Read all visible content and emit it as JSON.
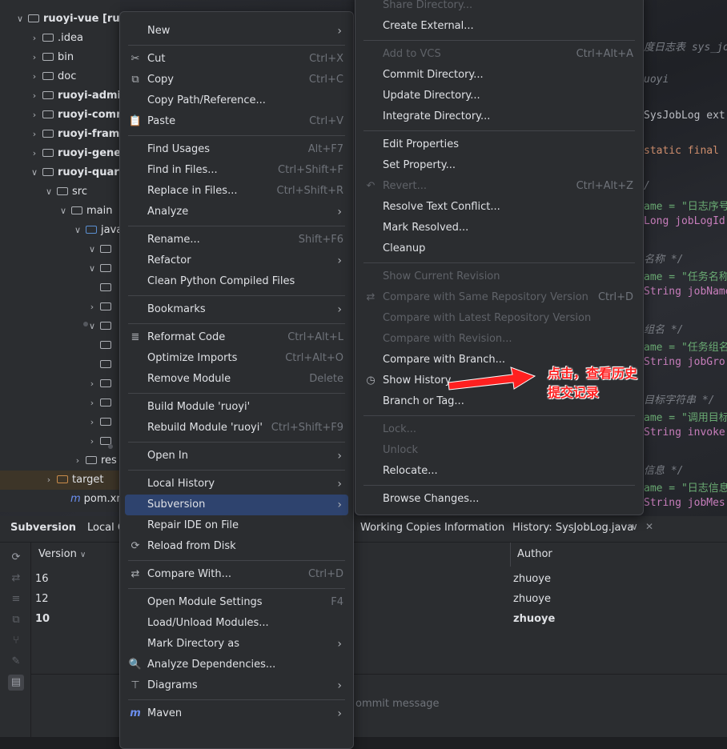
{
  "editor": {
    "lines": [
      {
        "text": "度日志表 sys_job",
        "cls": "c-cmt"
      },
      {
        "text": "uoyi",
        "cls": "c-cmt"
      },
      {
        "text": " SysJobLog ext",
        "cls": "c-plain"
      },
      {
        "text": "static final",
        "cls": "c-kw"
      },
      {
        "text": "/",
        "cls": "c-cmt"
      },
      {
        "text": "ame = \"日志序号",
        "cls": "c-str"
      },
      {
        "text": "Long jobLogId",
        "cls": "c-fld"
      },
      {
        "text": "名称 */",
        "cls": "c-cmt"
      },
      {
        "text": "ame = \"任务名称",
        "cls": "c-str"
      },
      {
        "text": "String jobName",
        "cls": "c-fld"
      },
      {
        "text": "组名 */",
        "cls": "c-cmt"
      },
      {
        "text": "ame = \"任务组名",
        "cls": "c-str"
      },
      {
        "text": "String jobGro",
        "cls": "c-fld"
      },
      {
        "text": "目标字符串 */",
        "cls": "c-cmt"
      },
      {
        "text": "ame = \"调用目标",
        "cls": "c-str"
      },
      {
        "text": "String invoke",
        "cls": "c-fld"
      },
      {
        "text": "信息 */",
        "cls": "c-cmt"
      },
      {
        "text": "ame = \"日志信息",
        "cls": "c-str"
      },
      {
        "text": "String jobMes",
        "cls": "c-fld"
      }
    ]
  },
  "tree": {
    "items": [
      {
        "label": "ruoyi-vue [ruoyi",
        "bold": true,
        "chev": "∨",
        "indent": 0
      },
      {
        "label": ".idea",
        "bold": false,
        "chev": "›",
        "indent": 1
      },
      {
        "label": "bin",
        "bold": false,
        "chev": "›",
        "indent": 1
      },
      {
        "label": "doc",
        "bold": false,
        "chev": "›",
        "indent": 1
      },
      {
        "label": "ruoyi-admin",
        "bold": true,
        "chev": "›",
        "indent": 1
      },
      {
        "label": "ruoyi-comm",
        "bold": true,
        "chev": "›",
        "indent": 1
      },
      {
        "label": "ruoyi-framew",
        "bold": true,
        "chev": "›",
        "indent": 1
      },
      {
        "label": "ruoyi-genera",
        "bold": true,
        "chev": "›",
        "indent": 1
      },
      {
        "label": "ruoyi-quartz",
        "bold": true,
        "chev": "∨",
        "indent": 1
      },
      {
        "label": "src",
        "bold": false,
        "chev": "∨",
        "indent": 2
      },
      {
        "label": "main",
        "bold": false,
        "chev": "∨",
        "indent": 3
      },
      {
        "label": "java",
        "bold": false,
        "chev": "∨",
        "indent": 4
      },
      {
        "label": "",
        "bold": false,
        "chev": "∨",
        "indent": 5
      },
      {
        "label": "",
        "bold": false,
        "chev": "∨",
        "indent": 5
      },
      {
        "label": "",
        "bold": false,
        "chev": "",
        "indent": 5
      },
      {
        "label": "",
        "bold": false,
        "chev": "›",
        "indent": 5
      },
      {
        "label": "",
        "bold": false,
        "chev": "∨",
        "indent": 5
      },
      {
        "label": "",
        "bold": false,
        "chev": "",
        "indent": 5
      },
      {
        "label": "",
        "bold": false,
        "chev": "",
        "indent": 5
      },
      {
        "label": "",
        "bold": false,
        "chev": "›",
        "indent": 5
      },
      {
        "label": "",
        "bold": false,
        "chev": "›",
        "indent": 5
      },
      {
        "label": "",
        "bold": false,
        "chev": "›",
        "indent": 5
      },
      {
        "label": "",
        "bold": false,
        "chev": "›",
        "indent": 5
      },
      {
        "label": "res",
        "bold": false,
        "chev": "›",
        "indent": 4
      },
      {
        "label": "target",
        "bold": false,
        "chev": "›",
        "indent": 2
      },
      {
        "label": "pom.xml",
        "bold": false,
        "chev": "",
        "indent": 3
      }
    ]
  },
  "bottom_panel": {
    "tabs": [
      "Subversion",
      "Local C",
      "Working Copies Information",
      "History: SysJobLog.java"
    ],
    "columns": {
      "version": "Version",
      "author": "Author"
    },
    "rows": [
      {
        "version": "16",
        "author": "zhuoye",
        "bold": false
      },
      {
        "version": "12",
        "author": "zhuoye",
        "bold": false
      },
      {
        "version": "10",
        "author": "zhuoye",
        "bold": true
      }
    ],
    "commit_placeholder": "ommit message"
  },
  "context_menu": {
    "items": [
      {
        "label": "New",
        "mn": "N",
        "shortcut": "",
        "submenu": true,
        "icon": ""
      },
      {
        "sep": true
      },
      {
        "label": "Cut",
        "mn": "t",
        "shortcut": "Ctrl+X",
        "icon": "✂"
      },
      {
        "label": "Copy",
        "mn": "C",
        "shortcut": "Ctrl+C",
        "icon": "⧉"
      },
      {
        "label": "Copy Path/Reference...",
        "shortcut": "",
        "icon": ""
      },
      {
        "label": "Paste",
        "mn": "P",
        "shortcut": "Ctrl+V",
        "icon": "📋"
      },
      {
        "sep": true
      },
      {
        "label": "Find Usages",
        "mn": "U",
        "shortcut": "Alt+F7",
        "icon": ""
      },
      {
        "label": "Find in Files...",
        "shortcut": "Ctrl+Shift+F",
        "icon": ""
      },
      {
        "label": "Replace in Files...",
        "mn": "a",
        "shortcut": "Ctrl+Shift+R",
        "icon": ""
      },
      {
        "label": "Analyze",
        "shortcut": "",
        "submenu": true,
        "icon": ""
      },
      {
        "sep": true
      },
      {
        "label": "Rename...",
        "mn": "R",
        "shortcut": "Shift+F6",
        "icon": ""
      },
      {
        "label": "Refactor",
        "mn": "R",
        "shortcut": "",
        "submenu": true,
        "icon": ""
      },
      {
        "label": "Clean Python Compiled Files",
        "shortcut": "",
        "icon": ""
      },
      {
        "sep": true
      },
      {
        "label": "Bookmarks",
        "shortcut": "",
        "submenu": true,
        "icon": ""
      },
      {
        "sep": true
      },
      {
        "label": "Reformat Code",
        "mn": "R",
        "shortcut": "Ctrl+Alt+L",
        "icon": "≣"
      },
      {
        "label": "Optimize Imports",
        "mn": "z",
        "shortcut": "Ctrl+Alt+O",
        "icon": ""
      },
      {
        "label": "Remove Module",
        "shortcut": "Delete",
        "icon": ""
      },
      {
        "sep": true
      },
      {
        "label": "Build Module 'ruoyi'",
        "mn": "M",
        "shortcut": "",
        "icon": ""
      },
      {
        "label": "Rebuild Module 'ruoyi'",
        "mn": "e",
        "shortcut": "Ctrl+Shift+F9",
        "icon": ""
      },
      {
        "sep": true
      },
      {
        "label": "Open In",
        "shortcut": "",
        "submenu": true,
        "icon": ""
      },
      {
        "sep": true
      },
      {
        "label": "Local History",
        "mn": "H",
        "shortcut": "",
        "submenu": true,
        "icon": ""
      },
      {
        "label": "Subversion",
        "mn": "S",
        "shortcut": "",
        "submenu": true,
        "icon": "",
        "selected": true
      },
      {
        "label": "Repair IDE on File",
        "shortcut": "",
        "icon": ""
      },
      {
        "label": "Reload from Disk",
        "shortcut": "",
        "icon": "⟳"
      },
      {
        "sep": true
      },
      {
        "label": "Compare With...",
        "shortcut": "Ctrl+D",
        "icon": "⇄"
      },
      {
        "sep": true
      },
      {
        "label": "Open Module Settings",
        "shortcut": "F4",
        "icon": ""
      },
      {
        "label": "Load/Unload Modules...",
        "shortcut": "",
        "icon": ""
      },
      {
        "label": "Mark Directory as",
        "shortcut": "",
        "submenu": true,
        "icon": ""
      },
      {
        "label": "Analyze Dependencies...",
        "shortcut": "",
        "icon": "🔍"
      },
      {
        "label": "Diagrams",
        "shortcut": "",
        "submenu": true,
        "icon": "⊤"
      },
      {
        "sep": true
      },
      {
        "label": "Maven",
        "shortcut": "",
        "submenu": true,
        "icon": "m"
      }
    ]
  },
  "svn_menu": {
    "items": [
      {
        "label": "Share Directory...",
        "shortcut": "",
        "disabled": true,
        "icon": ""
      },
      {
        "label": "Create External...",
        "shortcut": "",
        "icon": ""
      },
      {
        "sep": true
      },
      {
        "label": "Add to VCS",
        "shortcut": "Ctrl+Alt+A",
        "disabled": true,
        "icon": ""
      },
      {
        "label": "Commit Directory...",
        "mn": "i",
        "shortcut": "",
        "icon": ""
      },
      {
        "label": "Update Directory...",
        "mn": "U",
        "shortcut": "",
        "icon": ""
      },
      {
        "label": "Integrate Directory...",
        "shortcut": "",
        "icon": ""
      },
      {
        "sep": true
      },
      {
        "label": "Edit Properties",
        "mn": "P",
        "shortcut": "",
        "icon": ""
      },
      {
        "label": "Set Property...",
        "mn": "y",
        "shortcut": "",
        "icon": ""
      },
      {
        "label": "Revert...",
        "mn": "R",
        "shortcut": "Ctrl+Alt+Z",
        "disabled": true,
        "icon": "↶"
      },
      {
        "label": "Resolve Text Conflict...",
        "mn": "s",
        "shortcut": "",
        "icon": ""
      },
      {
        "label": "Mark Resolved...",
        "mn": "M",
        "shortcut": "",
        "icon": ""
      },
      {
        "label": "Cleanup",
        "mn": "e",
        "shortcut": "",
        "icon": ""
      },
      {
        "sep": true
      },
      {
        "label": "Show Current Revision",
        "shortcut": "",
        "disabled": true,
        "icon": ""
      },
      {
        "label": "Compare with Same Repository Version",
        "shortcut": "Ctrl+D",
        "disabled": true,
        "icon": "⇄"
      },
      {
        "label": "Compare with Latest Repository Version",
        "shortcut": "",
        "disabled": true,
        "icon": ""
      },
      {
        "label": "Compare with Revision...",
        "shortcut": "",
        "disabled": true,
        "icon": ""
      },
      {
        "label": "Compare with Branch...",
        "shortcut": "",
        "icon": ""
      },
      {
        "label": "Show History",
        "mn": "H",
        "shortcut": "",
        "icon": "◷"
      },
      {
        "label": "Branch or Tag...",
        "mn": "B",
        "shortcut": "",
        "icon": ""
      },
      {
        "sep": true
      },
      {
        "label": "Lock...",
        "shortcut": "",
        "disabled": true,
        "icon": ""
      },
      {
        "label": "Unlock",
        "shortcut": "",
        "disabled": true,
        "icon": ""
      },
      {
        "label": "Relocate...",
        "shortcut": "",
        "icon": ""
      },
      {
        "sep": true
      },
      {
        "label": "Browse Changes...",
        "shortcut": "",
        "icon": ""
      }
    ]
  },
  "annotation": {
    "line1": "点击，查看历史",
    "line2": "提交记录",
    "color": "#ff2020"
  },
  "colors": {
    "selection": "#2e436e",
    "background": "#1e1f22",
    "panel": "#2b2d30"
  }
}
